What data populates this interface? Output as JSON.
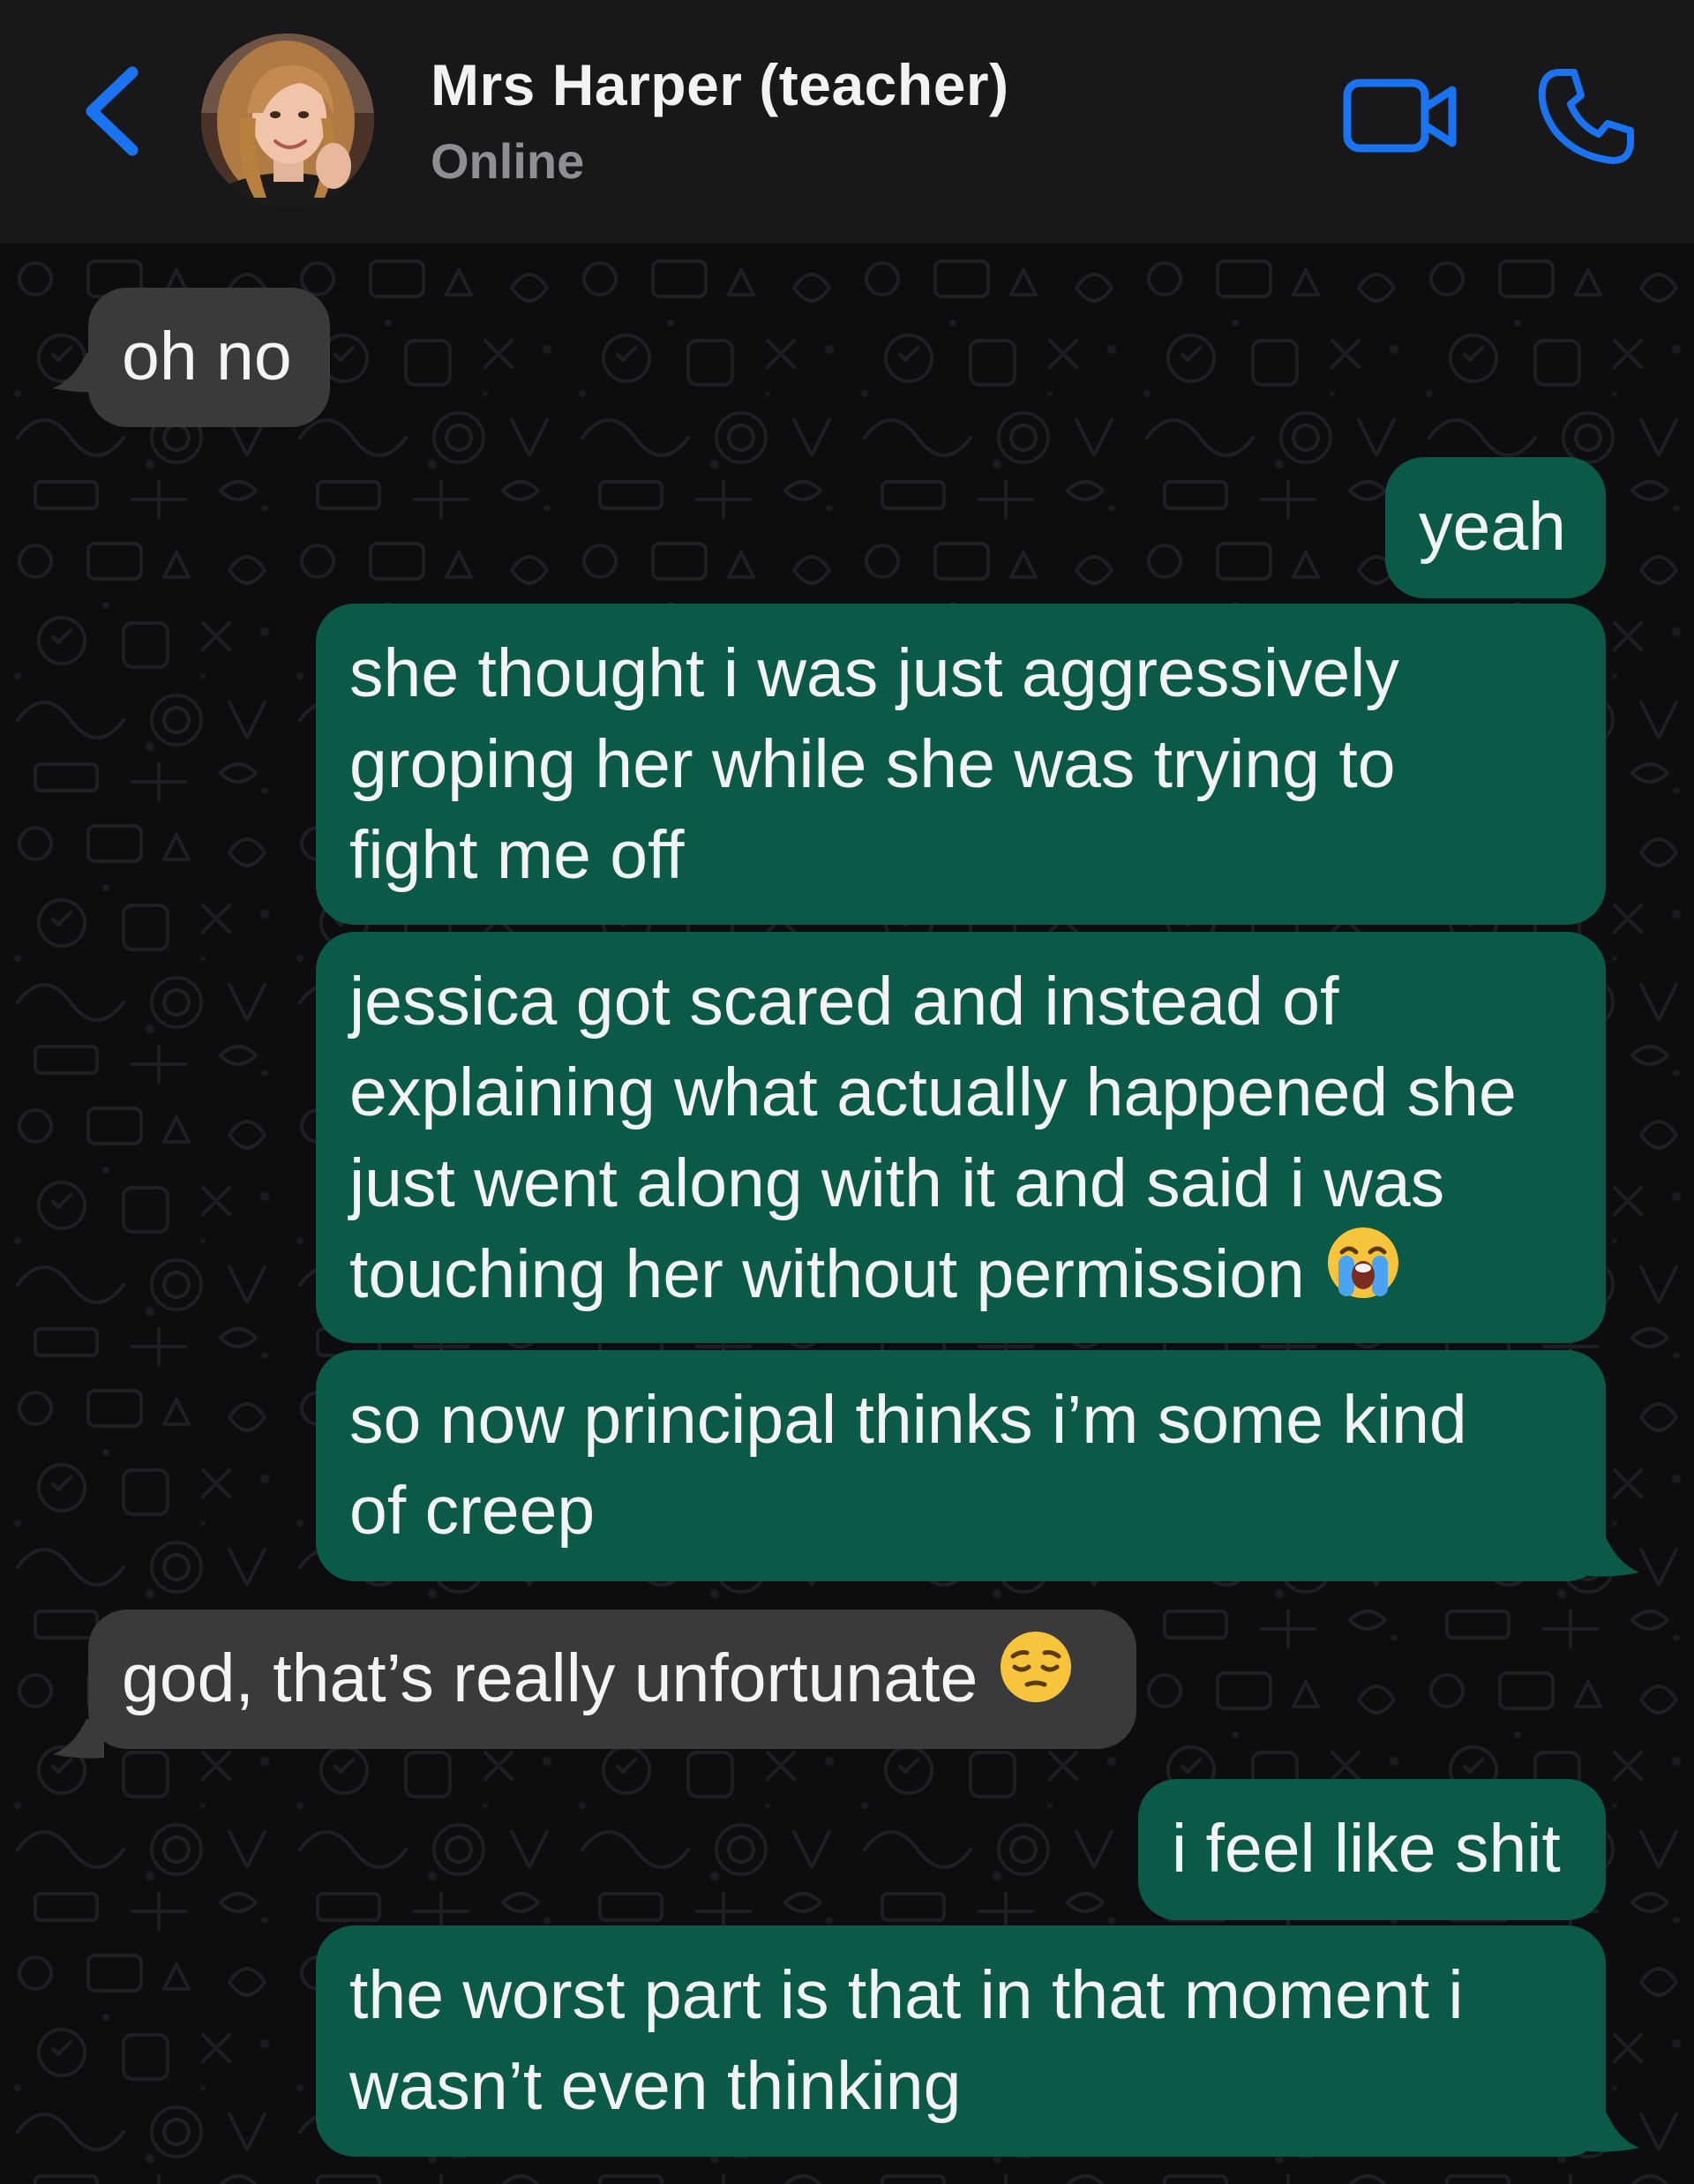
{
  "header": {
    "contact_name": "Mrs Harper (teacher)",
    "status": "Online",
    "back_icon": "chevron-left-icon",
    "video_icon": "video-camera-icon",
    "call_icon": "phone-icon",
    "accent_color": "#1a73f0"
  },
  "colors": {
    "incoming_bubble": "#3a3a3c",
    "outgoing_bubble": "#0b5a48",
    "background": "#0d0d10",
    "header_background": "#18181a"
  },
  "messages": [
    {
      "direction": "incoming",
      "lines": [
        "oh no"
      ]
    },
    {
      "direction": "outgoing",
      "lines": [
        "yeah"
      ]
    },
    {
      "direction": "outgoing",
      "lines": [
        "she thought i was just aggressively",
        "groping her while she was trying to",
        "fight me off"
      ]
    },
    {
      "direction": "outgoing",
      "lines": [
        "jessica got scared and instead of",
        "explaining what actually happened she",
        "just went along with it and said i was",
        "touching her without permission"
      ],
      "emoji": "loudly-crying-face"
    },
    {
      "direction": "outgoing",
      "lines": [
        "so now principal thinks i’m some kind",
        "of creep"
      ]
    },
    {
      "direction": "incoming",
      "lines": [
        "god, that’s really unfortunate"
      ],
      "emoji": "pensive-face"
    },
    {
      "direction": "outgoing",
      "lines": [
        "i feel like shit"
      ]
    },
    {
      "direction": "outgoing",
      "lines": [
        "the worst part is that in that moment i",
        "wasn’t even thinking"
      ]
    }
  ]
}
